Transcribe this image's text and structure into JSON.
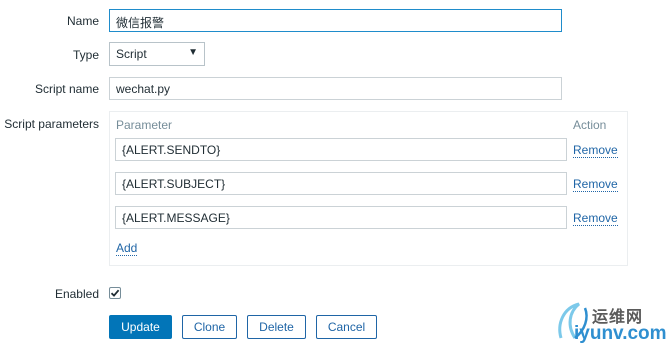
{
  "form": {
    "name_label": "Name",
    "name_value": "微信报警",
    "type_label": "Type",
    "type_value": "Script",
    "script_name_label": "Script name",
    "script_name_value": "wechat.py",
    "script_params_label": "Script parameters",
    "enabled_label": "Enabled",
    "enabled_checked": true
  },
  "params": {
    "col_parameter": "Parameter",
    "col_action": "Action",
    "rows": [
      {
        "value": "{ALERT.SENDTO}",
        "action": "Remove"
      },
      {
        "value": "{ALERT.SUBJECT}",
        "action": "Remove"
      },
      {
        "value": "{ALERT.MESSAGE}",
        "action": "Remove"
      }
    ],
    "add_label": "Add"
  },
  "buttons": {
    "update": "Update",
    "clone": "Clone",
    "delete": "Delete",
    "cancel": "Cancel"
  },
  "colors": {
    "primary": "#0275b8",
    "link": "#1f65a6",
    "focus_border": "#1f8ccb"
  },
  "watermark": {
    "line1": "运维网",
    "line2": "iyunv.com"
  }
}
